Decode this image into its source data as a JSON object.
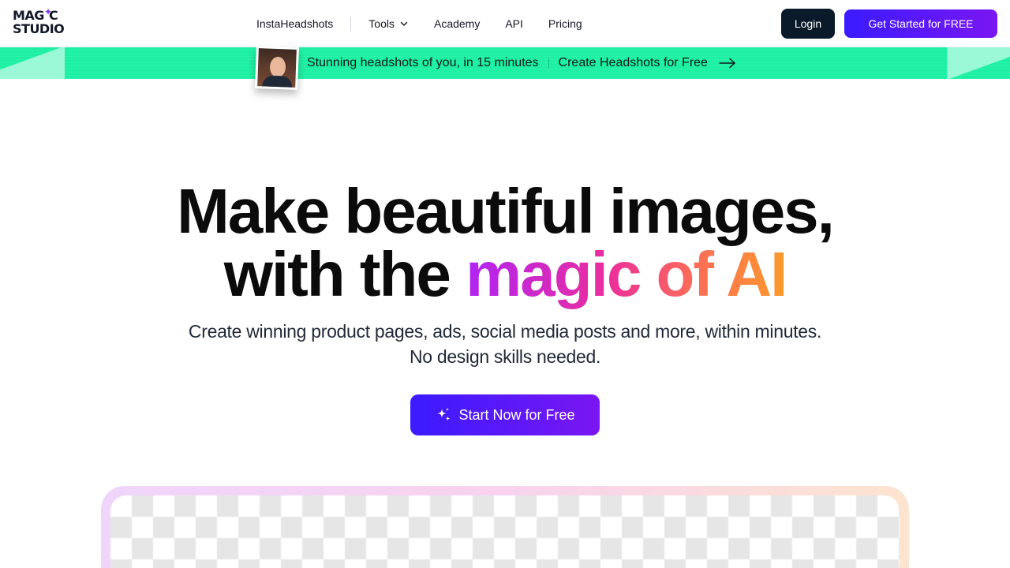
{
  "header": {
    "logo_line1": "MAG",
    "logo_line1b": "C",
    "logo_line2": "STUDIO",
    "nav": [
      {
        "label": "InstaHeadshots"
      },
      {
        "label": "Tools"
      },
      {
        "label": "Academy"
      },
      {
        "label": "API"
      },
      {
        "label": "Pricing"
      }
    ],
    "login_label": "Login",
    "get_started_label": "Get Started for FREE"
  },
  "banner": {
    "text": "Stunning headshots of you, in 15 minutes",
    "link": "Create Headshots for Free"
  },
  "hero": {
    "title_line1": "Make beautiful images,",
    "title_line2_plain": "with the",
    "title_line2_grad": "magic of AI",
    "subtitle_line1": "Create winning product pages, ads, social media posts and more, within minutes.",
    "subtitle_line2": "No design skills needed.",
    "cta_label": "Start Now for Free"
  },
  "colors": {
    "accent_start": "#3a1bff",
    "accent_end": "#7a16f2",
    "banner_green": "#1df0a2",
    "login_bg": "#0b1a2a"
  },
  "icons": [
    "sparkle-icon",
    "chevron-down-icon",
    "arrow-right-icon",
    "sparkles-icon"
  ]
}
